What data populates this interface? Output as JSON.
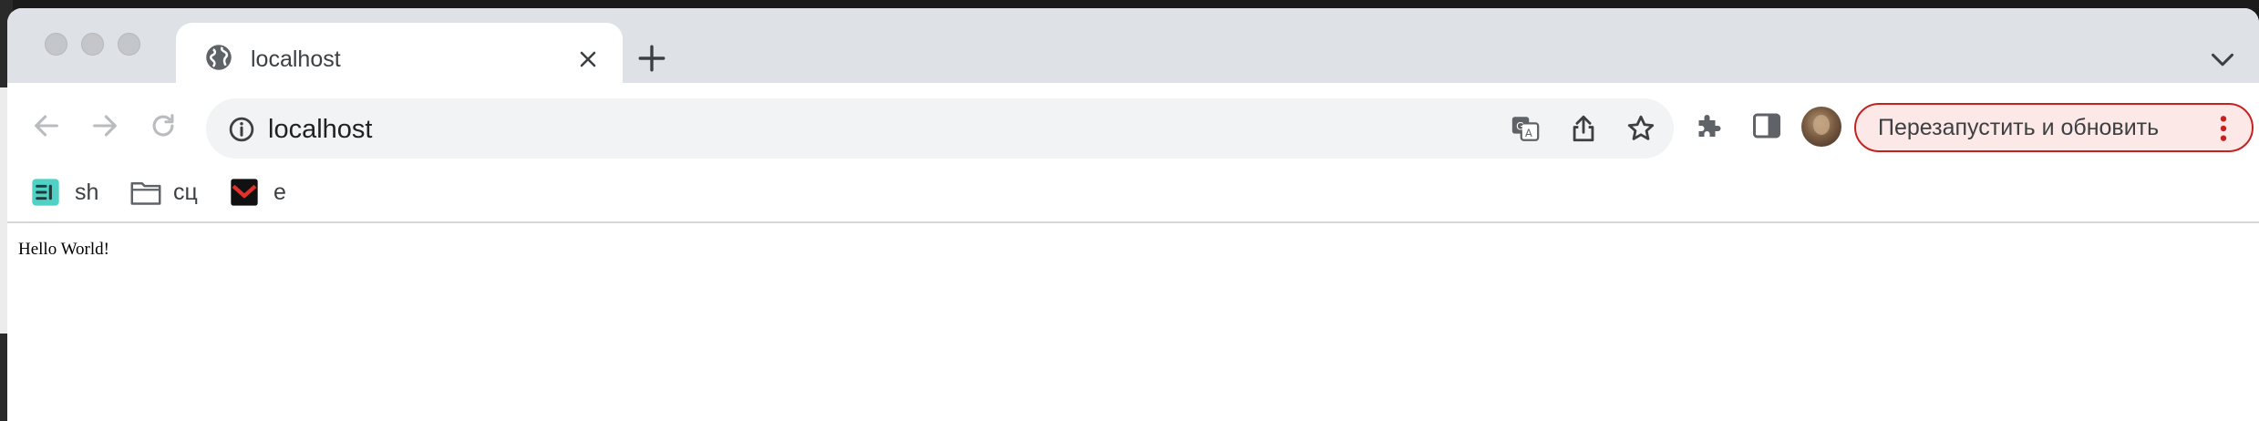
{
  "tab": {
    "title": "localhost"
  },
  "omnibox": {
    "url": "localhost"
  },
  "update_button": {
    "label": "Перезапустить и обновить"
  },
  "bookmarks": [
    {
      "label": "sh",
      "icon": "sh-app-icon"
    },
    {
      "label": "сц",
      "icon": "folder-icon"
    },
    {
      "label": "e",
      "icon": "mail-icon"
    }
  ],
  "page": {
    "text": "Hello World!"
  },
  "colors": {
    "tabstrip": "#dee1e6",
    "update_border": "#c5221f",
    "update_bg": "#fce8e6",
    "omnibox": "#f1f3f4"
  }
}
